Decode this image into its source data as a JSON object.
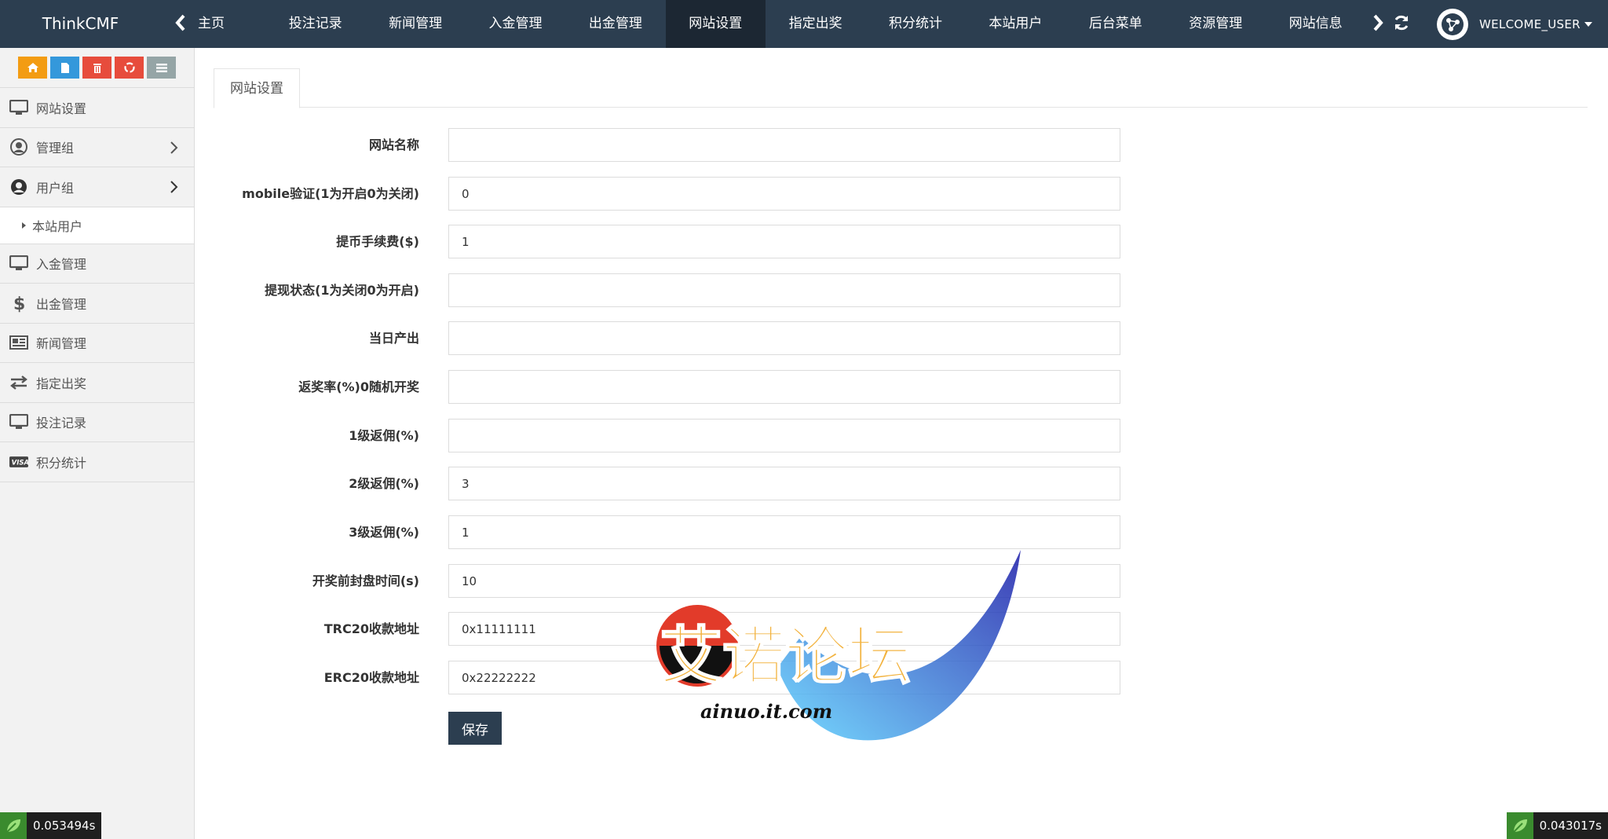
{
  "topbar": {
    "brand": "ThinkCMF",
    "home": "主页",
    "tabs": [
      "投注记录",
      "新闻管理",
      "入金管理",
      "出金管理",
      "网站设置",
      "指定出奖",
      "积分统计",
      "本站用户",
      "后台菜单",
      "资源管理",
      "网站信息"
    ],
    "active_tab": "网站设置",
    "user": "WELCOME_USER"
  },
  "sidebar": {
    "shortcut_colors": [
      "#f39c12",
      "#3498db",
      "#e74c3c",
      "#e74c3c",
      "#95a5a6"
    ],
    "items": [
      {
        "label": "网站设置",
        "icon": "monitor-icon"
      },
      {
        "label": "管理组",
        "icon": "user-circle-icon",
        "has_children": true
      },
      {
        "label": "用户组",
        "icon": "user-circle-icon",
        "has_children": true,
        "open": true
      },
      {
        "label": "入金管理",
        "icon": "monitor-icon"
      },
      {
        "label": "出金管理",
        "icon": "dollar-icon"
      },
      {
        "label": "新闻管理",
        "icon": "newspaper-icon"
      },
      {
        "label": "指定出奖",
        "icon": "exchange-icon"
      },
      {
        "label": "投注记录",
        "icon": "monitor-icon"
      },
      {
        "label": "积分统计",
        "icon": "visa-icon"
      }
    ],
    "submenu": {
      "label": "本站用户"
    }
  },
  "main": {
    "tab": "网站设置",
    "fields": [
      {
        "label": "网站名称",
        "value": ""
      },
      {
        "label": "mobile验证(1为开启0为关闭)",
        "value": "0"
      },
      {
        "label": "提币手续费($)",
        "value": "1"
      },
      {
        "label": "提现状态(1为关闭0为开启)",
        "value": ""
      },
      {
        "label": "当日产出",
        "value": ""
      },
      {
        "label": "返奖率(%)0随机开奖",
        "value": ""
      },
      {
        "label": "1级返佣(%)",
        "value": ""
      },
      {
        "label": "2级返佣(%)",
        "value": "3"
      },
      {
        "label": "3级返佣(%)",
        "value": "1"
      },
      {
        "label": "开奖前封盘时间(s)",
        "value": "10"
      },
      {
        "label": "TRC20收款地址",
        "value": "0x11111111"
      },
      {
        "label": "ERC20收款地址",
        "value": "0x22222222"
      }
    ],
    "save_label": "保存"
  },
  "timers": {
    "left": "0.053494s",
    "right": "0.043017s"
  },
  "watermark": {
    "title": "艾诺论坛",
    "url": "ainuo.it.com"
  },
  "colors": {
    "navbar": "#2c3e50",
    "active_tab": "#1c2733",
    "save_button": "#2c3e50"
  }
}
